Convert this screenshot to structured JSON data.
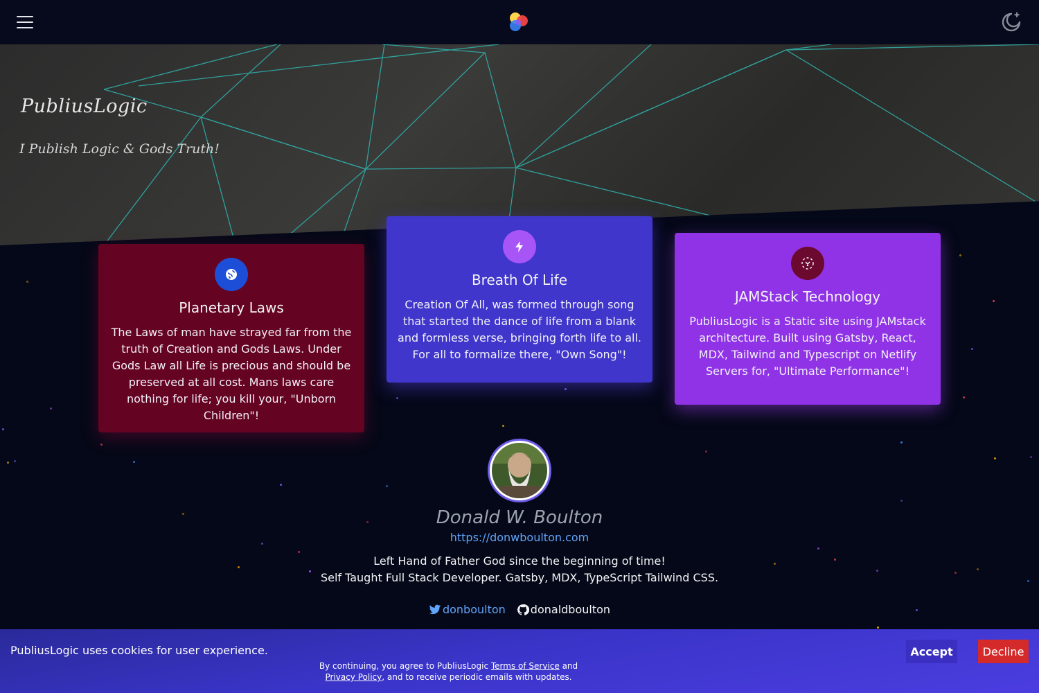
{
  "header": {
    "menu_icon": "hamburger-menu-icon",
    "logo_icon": "colorful-dots-logo",
    "theme_icon": "moon-star-icon"
  },
  "hero": {
    "title": "PubliusLogic",
    "subtitle": "I Publish Logic & Gods Truth!"
  },
  "cards": [
    {
      "title": "Planetary Laws",
      "icon": "globe-icon",
      "text": "The Laws of man have strayed far from the truth of Creation and Gods Laws. Under Gods Law all Life is precious and should be preserved at all cost. Mans laws care nothing for life; you kill your, \"Unborn Children\"!",
      "color": "#650322"
    },
    {
      "title": "Breath Of Life",
      "icon": "lightning-bolt-icon",
      "text": "Creation Of All, was formed through song that started the dance of life from a blank and formless verse, bringing forth life to all. For all to formalize there, \"Own Song\"!",
      "color": "#4036cc"
    },
    {
      "title": "JAMStack Technology",
      "icon": "jamstack-icon",
      "text": "PubliusLogic is a Static site using JAMstack architecture. Built using Gatsby, React, MDX, Tailwind and Typescript on Netlify Servers for, \"Ultimate Performance\"!",
      "color": "#9033e6"
    }
  ],
  "author": {
    "name": "Donald W. Boulton",
    "url": "https://donwboulton.com",
    "bio_line1": "Left Hand of Father God since the beginning of time!",
    "bio_line2": "Self Taught Full Stack Developer. Gatsby, MDX, TypeScript Tailwind CSS.",
    "twitter": "donboulton",
    "github": "donaldboulton"
  },
  "cookie": {
    "message": "PubliusLogic uses cookies for user experience.",
    "terms_prefix": "By continuing, you agree to PubliusLogic ",
    "terms_link": "Terms of Service",
    "terms_and": " and ",
    "privacy_link": "Privacy Policy",
    "terms_suffix": ", and to receive periodic emails with updates.",
    "accept_label": "Accept",
    "decline_label": "Decline"
  }
}
